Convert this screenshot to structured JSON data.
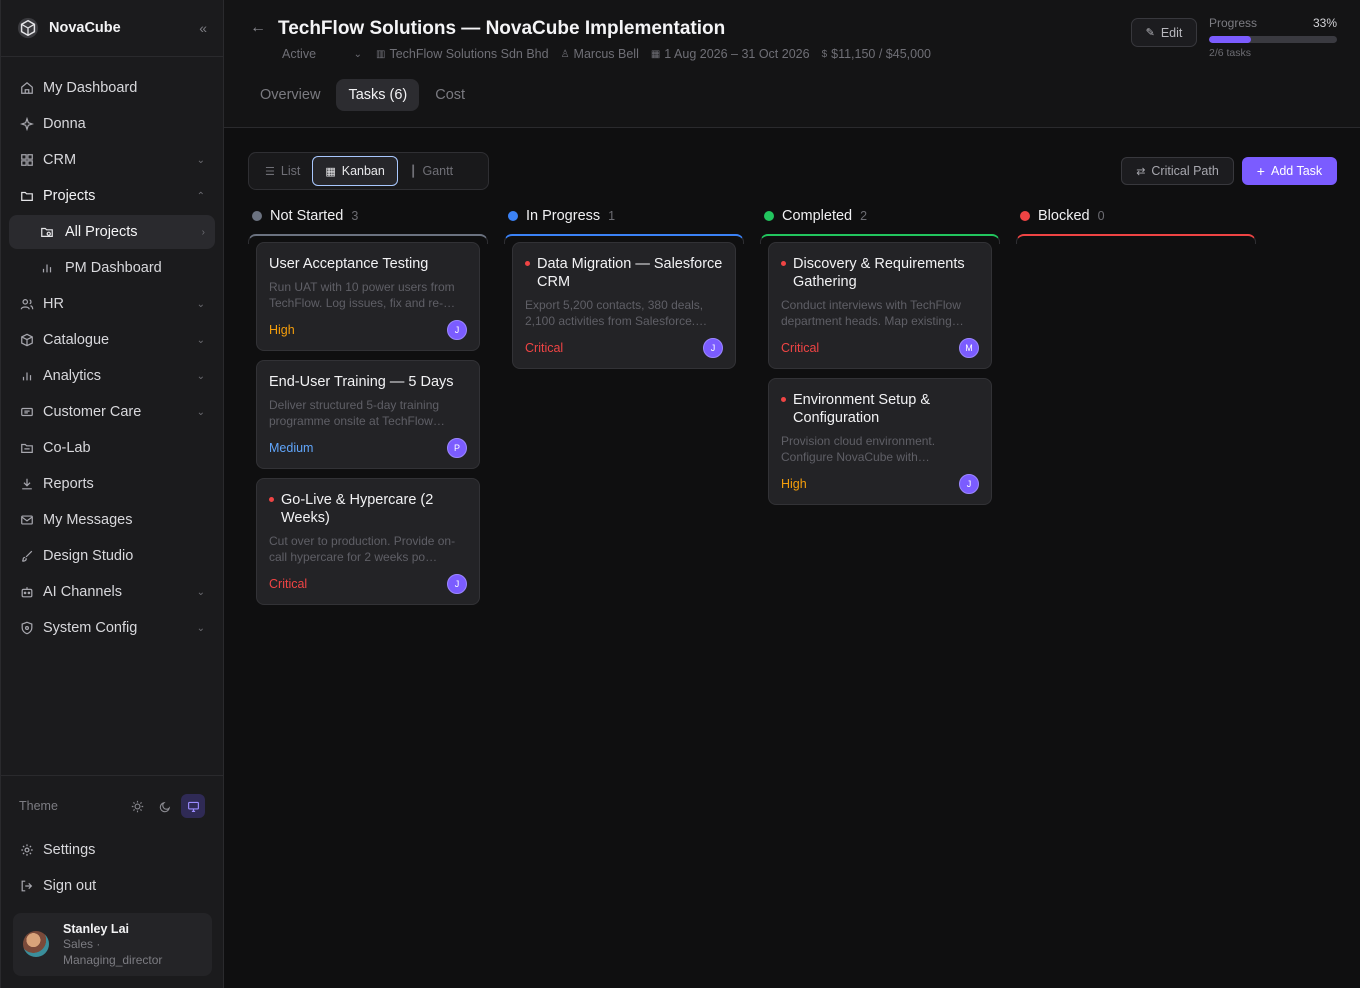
{
  "brand": {
    "name": "NovaCube"
  },
  "sidebar": {
    "items": [
      {
        "label": "My Dashboard"
      },
      {
        "label": "Donna"
      },
      {
        "label": "CRM"
      },
      {
        "label": "Projects"
      },
      {
        "label": "All Projects"
      },
      {
        "label": "PM Dashboard"
      },
      {
        "label": "HR"
      },
      {
        "label": "Catalogue"
      },
      {
        "label": "Analytics"
      },
      {
        "label": "Customer Care"
      },
      {
        "label": "Co-Lab"
      },
      {
        "label": "Reports"
      },
      {
        "label": "My Messages"
      },
      {
        "label": "Design Studio"
      },
      {
        "label": "AI Channels"
      },
      {
        "label": "System Config"
      }
    ],
    "theme_label": "Theme",
    "settings_label": "Settings",
    "signout_label": "Sign out",
    "user": {
      "name": "Stanley Lai",
      "dept": "Sales ·",
      "role": "Managing_director"
    }
  },
  "header": {
    "title": "TechFlow Solutions — NovaCube Implementation",
    "status": "Active",
    "company": "TechFlow Solutions Sdn Bhd",
    "owner": "Marcus Bell",
    "dates": "1 Aug 2026 – 31 Oct 2026",
    "budget": "$11,150 / $45,000",
    "edit_label": "Edit",
    "progress_label": "Progress",
    "progress_pct": "33%",
    "progress_value": 0.33,
    "progress_tasks": "2/6 tasks"
  },
  "tabs": [
    {
      "label": "Overview"
    },
    {
      "label": "Tasks (6)"
    },
    {
      "label": "Cost"
    }
  ],
  "toolbar": {
    "views": [
      {
        "label": "List"
      },
      {
        "label": "Kanban"
      },
      {
        "label": "Gantt"
      }
    ],
    "critical_path_label": "Critical Path",
    "add_task_label": "Add Task"
  },
  "columns": [
    {
      "name": "Not Started",
      "count": "3",
      "color": "#6b7280",
      "cards": [
        {
          "title": "User Acceptance Testing",
          "desc": "Run UAT with 10 power users from TechFlow. Log issues, fix and re-…",
          "priority": "High",
          "avatar": "J",
          "flag": false
        },
        {
          "title": "End-User Training — 5 Days",
          "desc": "Deliver structured 5-day training programme onsite at TechFlow…",
          "priority": "Medium",
          "avatar": "P",
          "flag": false
        },
        {
          "title": "Go-Live & Hypercare (2 Weeks)",
          "desc": "Cut over to production. Provide on-call hypercare for 2 weeks po…",
          "priority": "Critical",
          "avatar": "J",
          "flag": true
        }
      ]
    },
    {
      "name": "In Progress",
      "count": "1",
      "color": "#3b82f6",
      "cards": [
        {
          "title": "Data Migration — Salesforce CRM",
          "desc": "Export 5,200 contacts, 380 deals, 2,100 activities from Salesforce.…",
          "priority": "Critical",
          "avatar": "J",
          "flag": true
        }
      ]
    },
    {
      "name": "Completed",
      "count": "2",
      "color": "#22c55e",
      "cards": [
        {
          "title": "Discovery & Requirements Gathering",
          "desc": "Conduct interviews with TechFlow department heads. Map existing…",
          "priority": "Critical",
          "avatar": "M",
          "flag": true
        },
        {
          "title": "Environment Setup & Configuration",
          "desc": "Provision cloud environment. Configure NovaCube with…",
          "priority": "High",
          "avatar": "J",
          "flag": true
        }
      ]
    },
    {
      "name": "Blocked",
      "count": "0",
      "color": "#ef4444",
      "cards": []
    }
  ],
  "priority_colors": {
    "High": "#f59e0b",
    "Medium": "#60a5fa",
    "Critical": "#ef4444"
  }
}
